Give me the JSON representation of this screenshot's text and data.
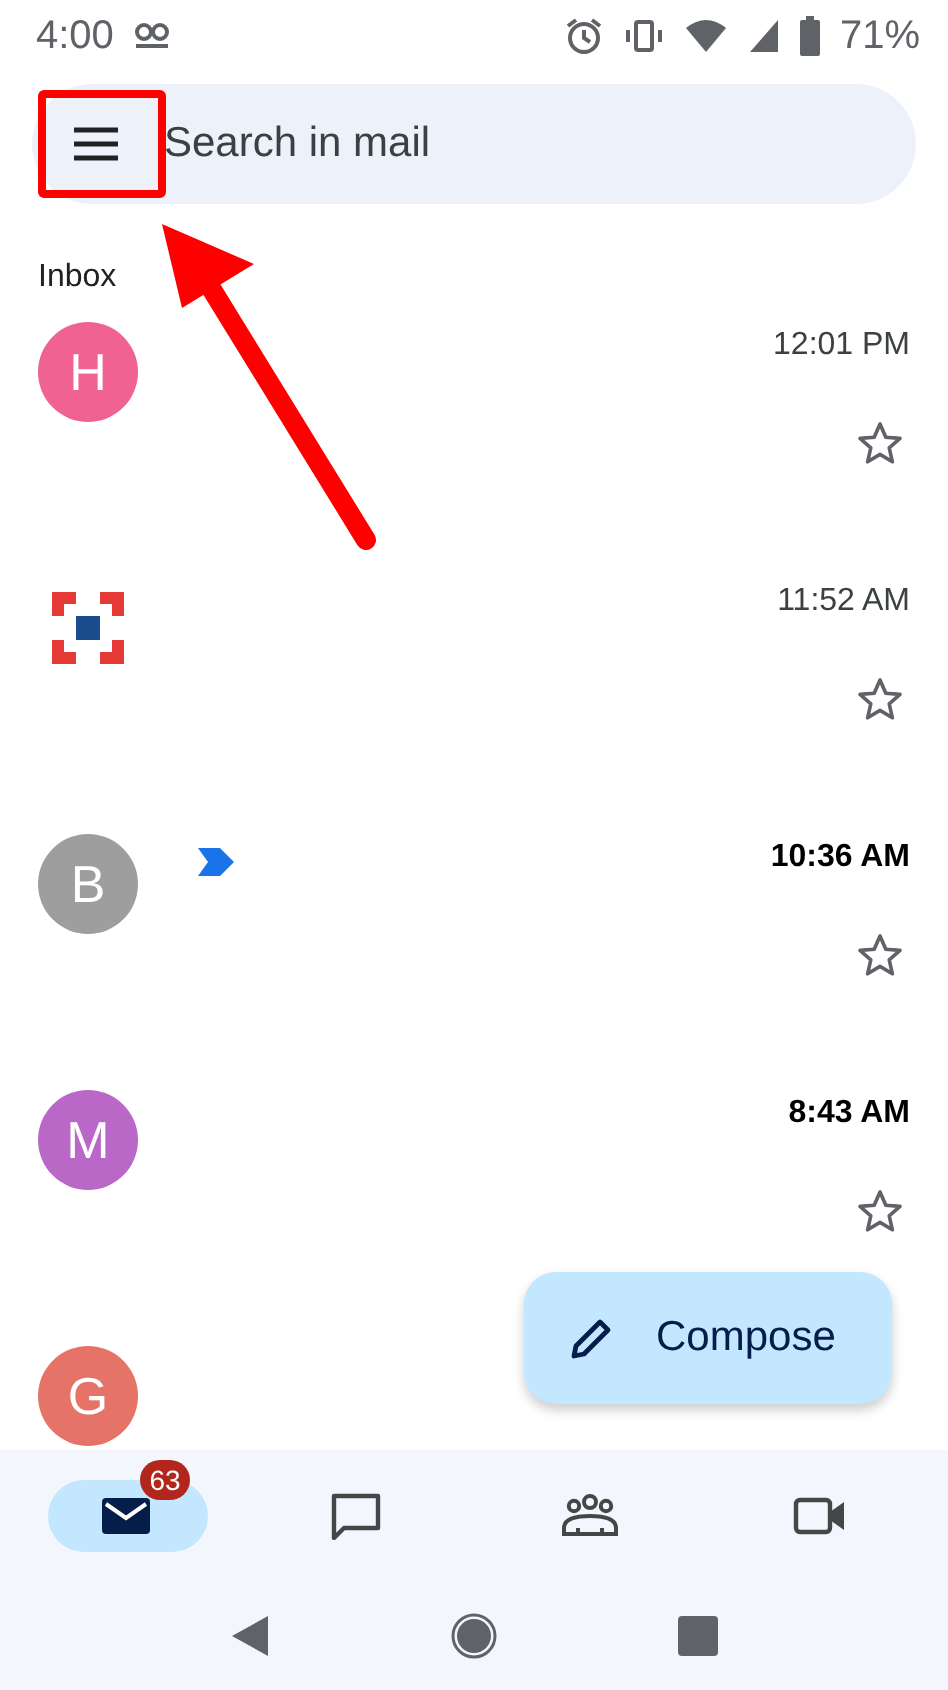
{
  "status_bar": {
    "time": "4:00",
    "battery": "71%"
  },
  "search": {
    "placeholder": "Search in mail"
  },
  "section_title": "Inbox",
  "emails": [
    {
      "kind": "letter",
      "initial": "H",
      "color": "#f06292",
      "time": "12:01 PM",
      "unread": false,
      "important": false,
      "starred": false
    },
    {
      "kind": "logo",
      "time": "11:52 AM",
      "unread": false,
      "important": false,
      "starred": false
    },
    {
      "kind": "letter",
      "initial": "B",
      "color": "#9e9e9e",
      "time": "10:36 AM",
      "unread": true,
      "important": true,
      "starred": false
    },
    {
      "kind": "letter",
      "initial": "M",
      "color": "#ba68c8",
      "time": "8:43 AM",
      "unread": true,
      "important": false,
      "starred": false
    },
    {
      "kind": "letter",
      "initial": "G",
      "color": "#e57368"
    }
  ],
  "compose": {
    "label": "Compose"
  },
  "bottom_nav": [
    {
      "kind": "mail",
      "selected": true,
      "badge": "63"
    },
    {
      "kind": "chat",
      "selected": false
    },
    {
      "kind": "spaces",
      "selected": false
    },
    {
      "kind": "meet",
      "selected": false
    }
  ]
}
